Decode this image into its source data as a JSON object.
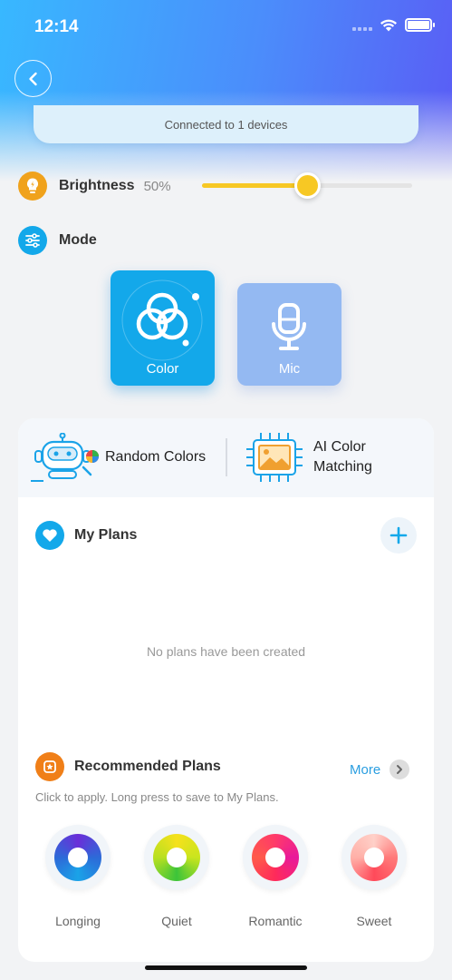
{
  "status_bar": {
    "time": "12:14"
  },
  "connection": {
    "text": "Connected to 1 devices"
  },
  "brightness": {
    "label": "Brightness",
    "value_text": "50%",
    "level": 0.5
  },
  "mode": {
    "label": "Mode",
    "options": [
      {
        "label": "Color",
        "selected": true
      },
      {
        "label": "Mic",
        "selected": false
      }
    ]
  },
  "features": {
    "random_colors": "Random Colors",
    "ai_color_matching_line1": "AI Color",
    "ai_color_matching_line2": "Matching"
  },
  "my_plans": {
    "title": "My Plans",
    "empty_text": "No plans have been created"
  },
  "recommended": {
    "title": "Recommended Plans",
    "more_label": "More",
    "hint": "Click to apply. Long press to save to My Plans.",
    "plans": [
      {
        "label": "Longing"
      },
      {
        "label": "Quiet"
      },
      {
        "label": "Romantic"
      },
      {
        "label": "Sweet"
      }
    ]
  },
  "colors": {
    "accent": "#13a8ea",
    "brightness_icon": "#f0a21c",
    "slider": "#f7c824",
    "recommended_icon": "#f07f18"
  }
}
